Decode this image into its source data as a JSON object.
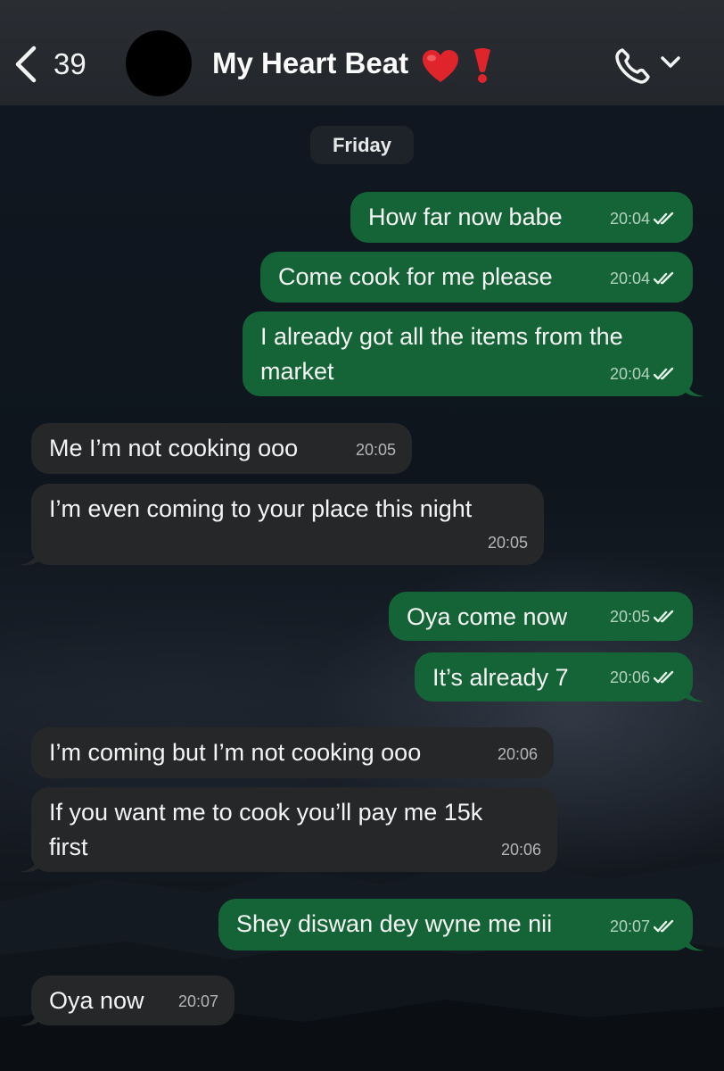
{
  "header": {
    "back_count": "39",
    "contact_name": "My Heart Beat",
    "icons": [
      "chevron-left-icon",
      "red-heart-icon",
      "red-exclamation-icon",
      "phone-icon",
      "chevron-down-icon"
    ]
  },
  "date_chip": "Friday",
  "messages": [
    {
      "dir": "out",
      "lines": [
        "How far now babe"
      ],
      "time": "20:04",
      "status": "read"
    },
    {
      "dir": "out",
      "lines": [
        "Come cook for me please"
      ],
      "time": "20:04",
      "status": "read"
    },
    {
      "dir": "out",
      "lines": [
        "I already got all the items from the",
        "market"
      ],
      "time": "20:04",
      "status": "read"
    },
    {
      "dir": "in",
      "lines": [
        "Me I’m not cooking ooo"
      ],
      "time": "20:05"
    },
    {
      "dir": "in",
      "lines": [
        "I’m even coming to your place this night"
      ],
      "time": "20:05"
    },
    {
      "dir": "out",
      "lines": [
        "Oya come now"
      ],
      "time": "20:05",
      "status": "read"
    },
    {
      "dir": "out",
      "lines": [
        "It’s already 7"
      ],
      "time": "20:06",
      "status": "read"
    },
    {
      "dir": "in",
      "lines": [
        "I’m coming but I’m not cooking ooo"
      ],
      "time": "20:06"
    },
    {
      "dir": "in",
      "lines": [
        "If you want me to cook you’ll pay me 15k",
        "first"
      ],
      "time": "20:06"
    },
    {
      "dir": "out",
      "lines": [
        "Shey diswan dey wyne me nii"
      ],
      "time": "20:07",
      "status": "read"
    },
    {
      "dir": "in",
      "lines": [
        "Oya now"
      ],
      "time": "20:07"
    }
  ],
  "colors": {
    "outgoing_bubble": "#156437",
    "incoming_bubble": "#262729",
    "header_bg": "#2a2e33",
    "heart": "#e0242c"
  }
}
